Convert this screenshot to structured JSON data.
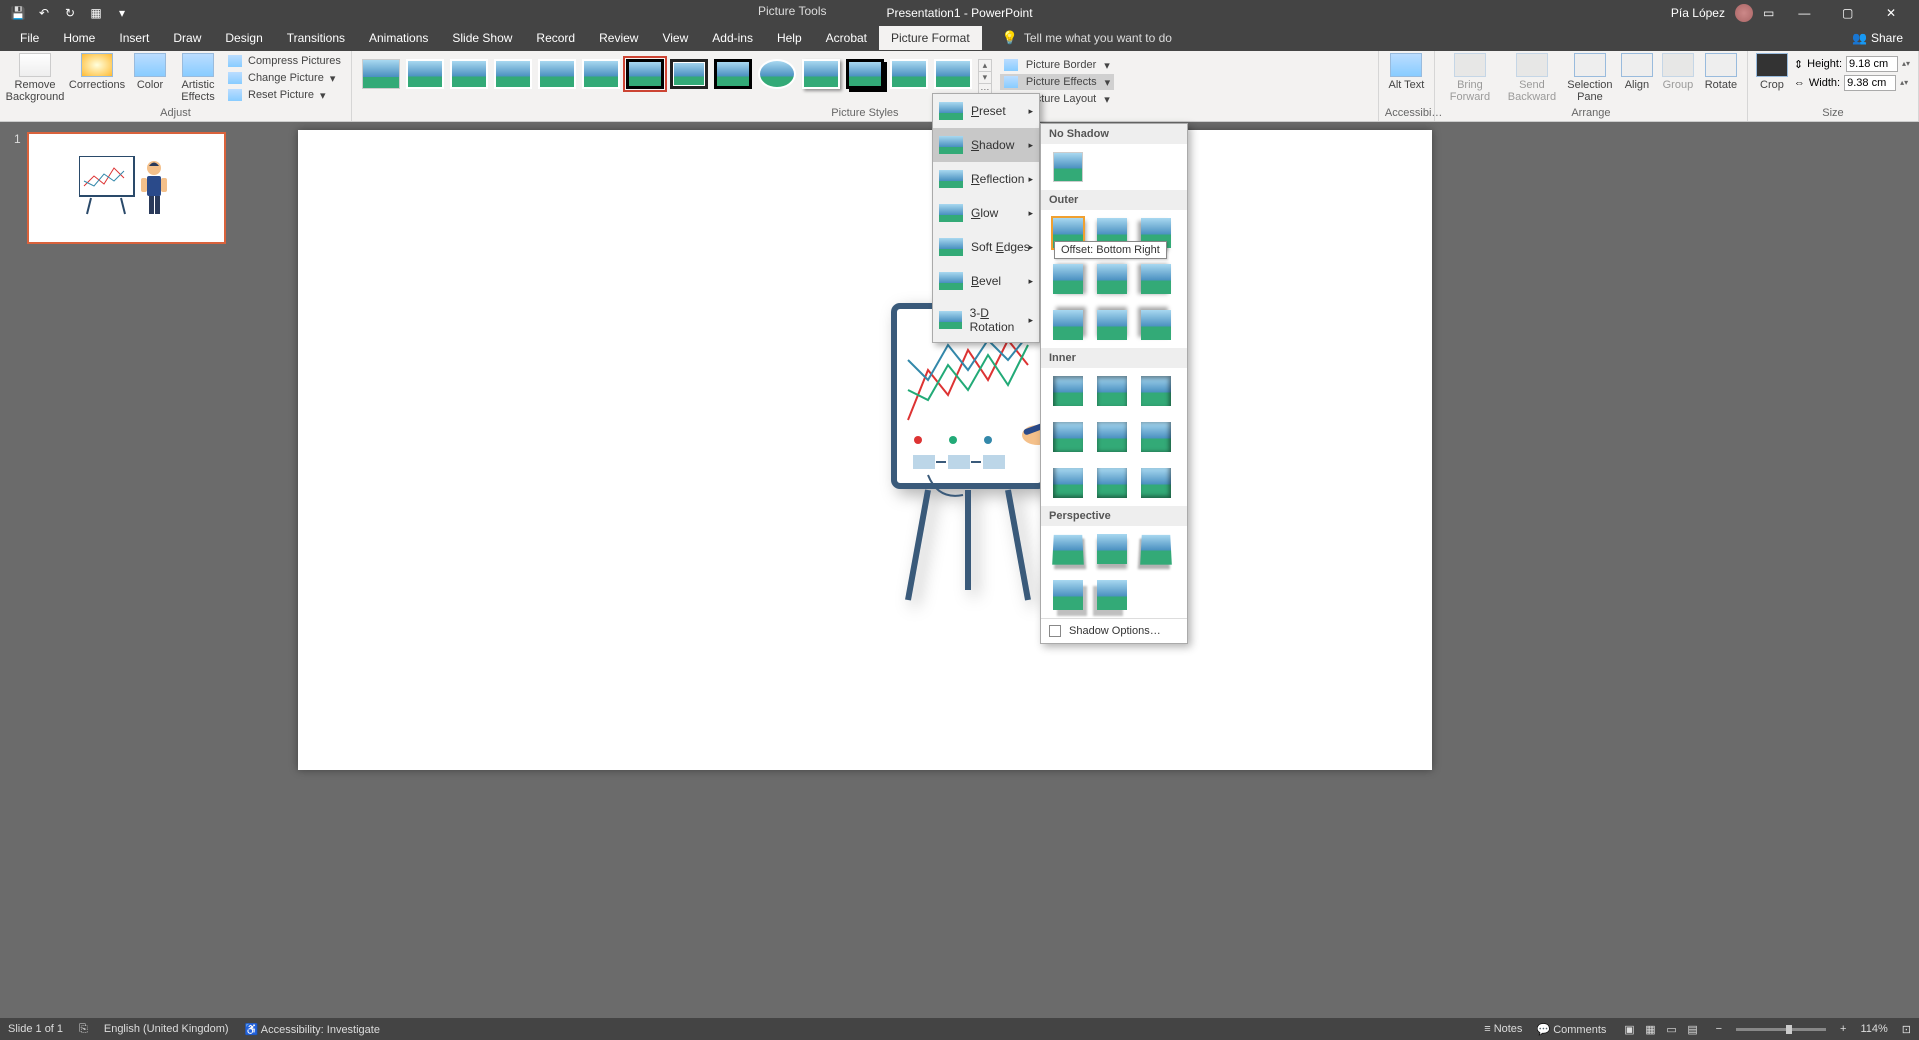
{
  "titlebar": {
    "title": "Presentation1 - PowerPoint",
    "tools_label": "Picture Tools",
    "user": "Pía López"
  },
  "tabs": {
    "file": "File",
    "home": "Home",
    "insert": "Insert",
    "draw": "Draw",
    "design": "Design",
    "transitions": "Transitions",
    "animations": "Animations",
    "slideshow": "Slide Show",
    "record": "Record",
    "review": "Review",
    "view": "View",
    "addins": "Add-ins",
    "help": "Help",
    "acrobat": "Acrobat",
    "picture_format": "Picture Format",
    "tellme": "Tell me what you want to do",
    "share": "Share"
  },
  "ribbon": {
    "adjust": {
      "label": "Adjust",
      "remove_bg": "Remove\nBackground",
      "corrections": "Corrections",
      "color": "Color",
      "artistic": "Artistic\nEffects",
      "compress": "Compress Pictures",
      "change": "Change Picture",
      "reset": "Reset Picture"
    },
    "styles": {
      "label": "Picture Styles",
      "border": "Picture Border",
      "effects": "Picture Effects",
      "layout": "Picture Layout"
    },
    "accessibility": {
      "label": "Accessibi…",
      "alt": "Alt\nText"
    },
    "arrange": {
      "label": "Arrange",
      "forward": "Bring\nForward",
      "backward": "Send\nBackward",
      "selection": "Selection\nPane",
      "align": "Align",
      "group": "Group",
      "rotate": "Rotate"
    },
    "size": {
      "label": "Size",
      "crop": "Crop",
      "height_label": "Height:",
      "width_label": "Width:",
      "height": "9.18 cm",
      "width": "9.38 cm"
    }
  },
  "effects_menu": {
    "preset": "Preset",
    "shadow": "Shadow",
    "reflection": "Reflection",
    "glow": "Glow",
    "soft_edges": "Soft Edges",
    "bevel": "Bevel",
    "rotation": "3-D Rotation"
  },
  "shadow_gallery": {
    "no_shadow": "No Shadow",
    "outer": "Outer",
    "inner": "Inner",
    "perspective": "Perspective",
    "options": "Shadow Options…"
  },
  "tooltip": "Offset: Bottom Right",
  "thumbs": {
    "n1": "1"
  },
  "status": {
    "slide": "Slide 1 of 1",
    "lang": "English (United Kingdom)",
    "access": "Accessibility: Investigate",
    "notes": "Notes",
    "comments": "Comments",
    "zoom": "114%"
  }
}
